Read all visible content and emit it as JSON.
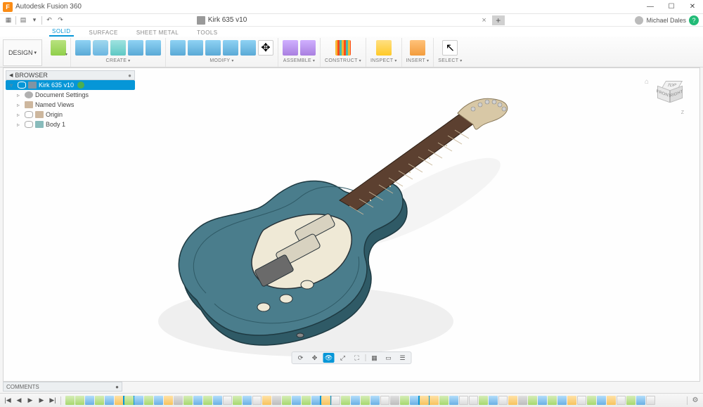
{
  "app": {
    "title": "Autodesk Fusion 360",
    "icon_letter": "F"
  },
  "window_controls": {
    "min": "—",
    "max": "☐",
    "close": "✕"
  },
  "qat": {
    "grid": "▦",
    "file": "▤",
    "save": "▾",
    "undo": "↶",
    "redo": "↷"
  },
  "tab": {
    "name": "Kirk 635 v10",
    "close": "×",
    "plus": "+"
  },
  "user": {
    "name": "Michael Dales",
    "help": "?"
  },
  "ribbon_tabs": [
    "SOLID",
    "SURFACE",
    "SHEET METAL",
    "TOOLS"
  ],
  "design_btn": "DESIGN",
  "ribbon_groups": {
    "create": "CREATE",
    "modify": "MODIFY",
    "assemble": "ASSEMBLE",
    "construct": "CONSTRUCT",
    "inspect": "INSPECT",
    "insert": "INSERT",
    "select": "SELECT"
  },
  "browser": {
    "title": "BROWSER",
    "root": "Kirk 635 v10",
    "items": [
      {
        "label": "Document Settings"
      },
      {
        "label": "Named Views"
      },
      {
        "label": "Origin"
      },
      {
        "label": "Body 1"
      }
    ]
  },
  "viewcube": {
    "top": "TOP",
    "front": "FRONT",
    "right": "RIGHT",
    "z": "Z"
  },
  "comments": {
    "title": "COMMENTS"
  },
  "navbar": {
    "orbit": "⟳",
    "pan": "✥",
    "look": "👁",
    "zoom": "⤢",
    "fit": "⛶",
    "display1": "▦",
    "display2": "▭",
    "display3": "☰"
  },
  "timeline": {
    "start": "|◀",
    "back": "◀",
    "play": "▶",
    "fwd": "▶",
    "end": "▶|",
    "gear": "⚙",
    "items": [
      "sk",
      "sk",
      "ex",
      "sk",
      "ex",
      "fl",
      "sk",
      "ex",
      "sk",
      "ex",
      "fl",
      "pl",
      "sk",
      "ex",
      "sk",
      "ex",
      "op",
      "sk",
      "ex",
      "op",
      "fl",
      "pl",
      "sk",
      "ex",
      "sk",
      "ex",
      "fl",
      "op",
      "sk",
      "ex",
      "sk",
      "ex",
      "op",
      "pl",
      "sk",
      "ex",
      "fl",
      "fl",
      "sk",
      "ex",
      "op",
      "op",
      "sk",
      "ex",
      "op",
      "fl",
      "pl",
      "sk",
      "ex",
      "sk",
      "ex",
      "fl",
      "op",
      "sk",
      "ex",
      "fl",
      "op",
      "sk",
      "ex",
      "op"
    ],
    "highlight": [
      6,
      26,
      36
    ]
  },
  "model": {
    "name": "Electric guitar body",
    "body_color": "#4a7d8c",
    "fretboard_color": "#5c4030",
    "headstock_color": "#d8c8a6"
  }
}
